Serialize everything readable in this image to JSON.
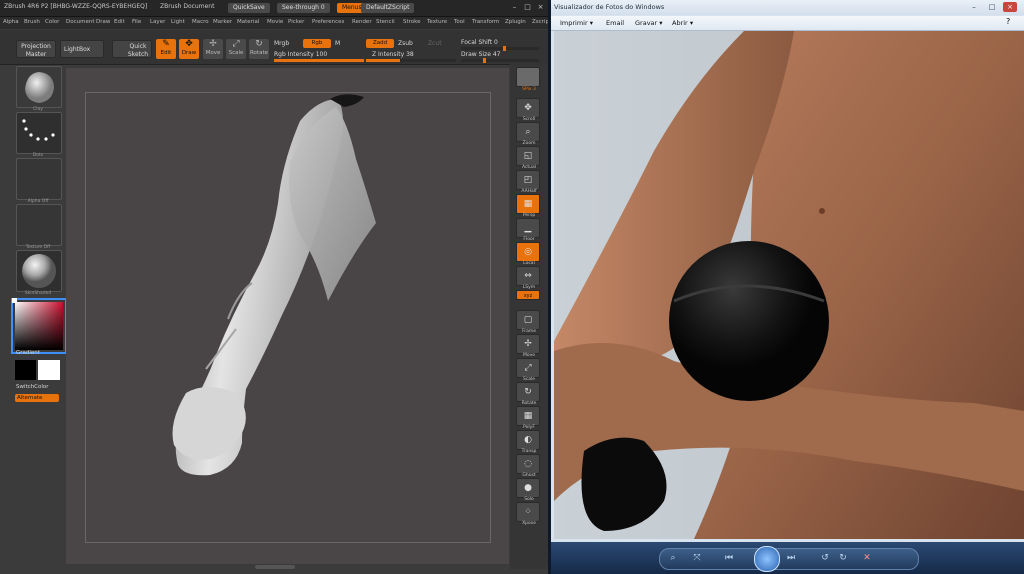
{
  "zbrush": {
    "title_bar": {
      "app": "ZBrush 4R6 P2 [BHBG-WZZE-QQRS-EYBEHGEQ]",
      "doc": "ZBrush Document",
      "quicksave": "QuickSave",
      "see_through": "See-through",
      "see_through_value": "0",
      "menus": "Menus",
      "script": "DefaultZScript"
    },
    "menu": [
      "Alpha",
      "Brush",
      "Color",
      "Document",
      "Draw",
      "Edit",
      "File",
      "Layer",
      "Light",
      "Macro",
      "Marker",
      "Material",
      "Movie",
      "Picker",
      "Preferences",
      "Render",
      "Stencil",
      "Stroke",
      "Texture",
      "Tool",
      "Transform",
      "Zplugin",
      "Zscript"
    ],
    "shelf": {
      "projection_master": "Projection Master",
      "lightbox": "LightBox",
      "quick_sketch": "Quick Sketch",
      "edit": "Edit",
      "draw": "Draw",
      "move": "Move",
      "scale": "Scale",
      "rotate": "Rotate",
      "mrgb": "Mrgb",
      "rgb": "Rgb",
      "m": "M",
      "rgb_intensity_label": "Rgb Intensity",
      "rgb_intensity_value": "100",
      "zadd": "Zadd",
      "zsub": "Zsub",
      "zcut": "Zcut",
      "z_intensity_label": "Z Intensity",
      "z_intensity_value": "38",
      "focal_shift_label": "Focal Shift",
      "focal_shift_value": "0",
      "draw_size_label": "Draw Size",
      "draw_size_value": "47"
    },
    "left_tray": {
      "brush_caption": "Clay",
      "stroke_caption": "Dots",
      "alpha_caption": "Alpha Off",
      "texture_caption": "Texture Off",
      "material_caption": "SkinShade4",
      "gradient": "Gradient",
      "switch_color": "SwitchColor",
      "alternate": "Alternate"
    },
    "right_tray": {
      "spix_label": "SPix",
      "spix_value": "3",
      "tools": [
        "Scroll",
        "Zoom",
        "Actual",
        "AAHalf",
        "Persp",
        "Floor",
        "Local",
        "LSym",
        "Gxyz",
        "Frame",
        "Move",
        "Scale",
        "Rotate",
        "PolyF",
        "Transp",
        "Ghost",
        "Solo",
        "Xpose"
      ]
    }
  },
  "photo_viewer": {
    "title": "Visualizador de Fotos do Windows",
    "menu": {
      "print": "Imprimir",
      "email": "Email",
      "burn": "Gravar",
      "open": "Abrir"
    },
    "icons": [
      "zoom-icon",
      "actual-size-icon",
      "previous-icon",
      "slideshow-icon",
      "next-icon",
      "rotate-left-icon",
      "rotate-right-icon",
      "delete-icon"
    ]
  },
  "colors": {
    "zbrush_accent": "#e8730c",
    "viewer_bar": "#1e3a5f"
  }
}
